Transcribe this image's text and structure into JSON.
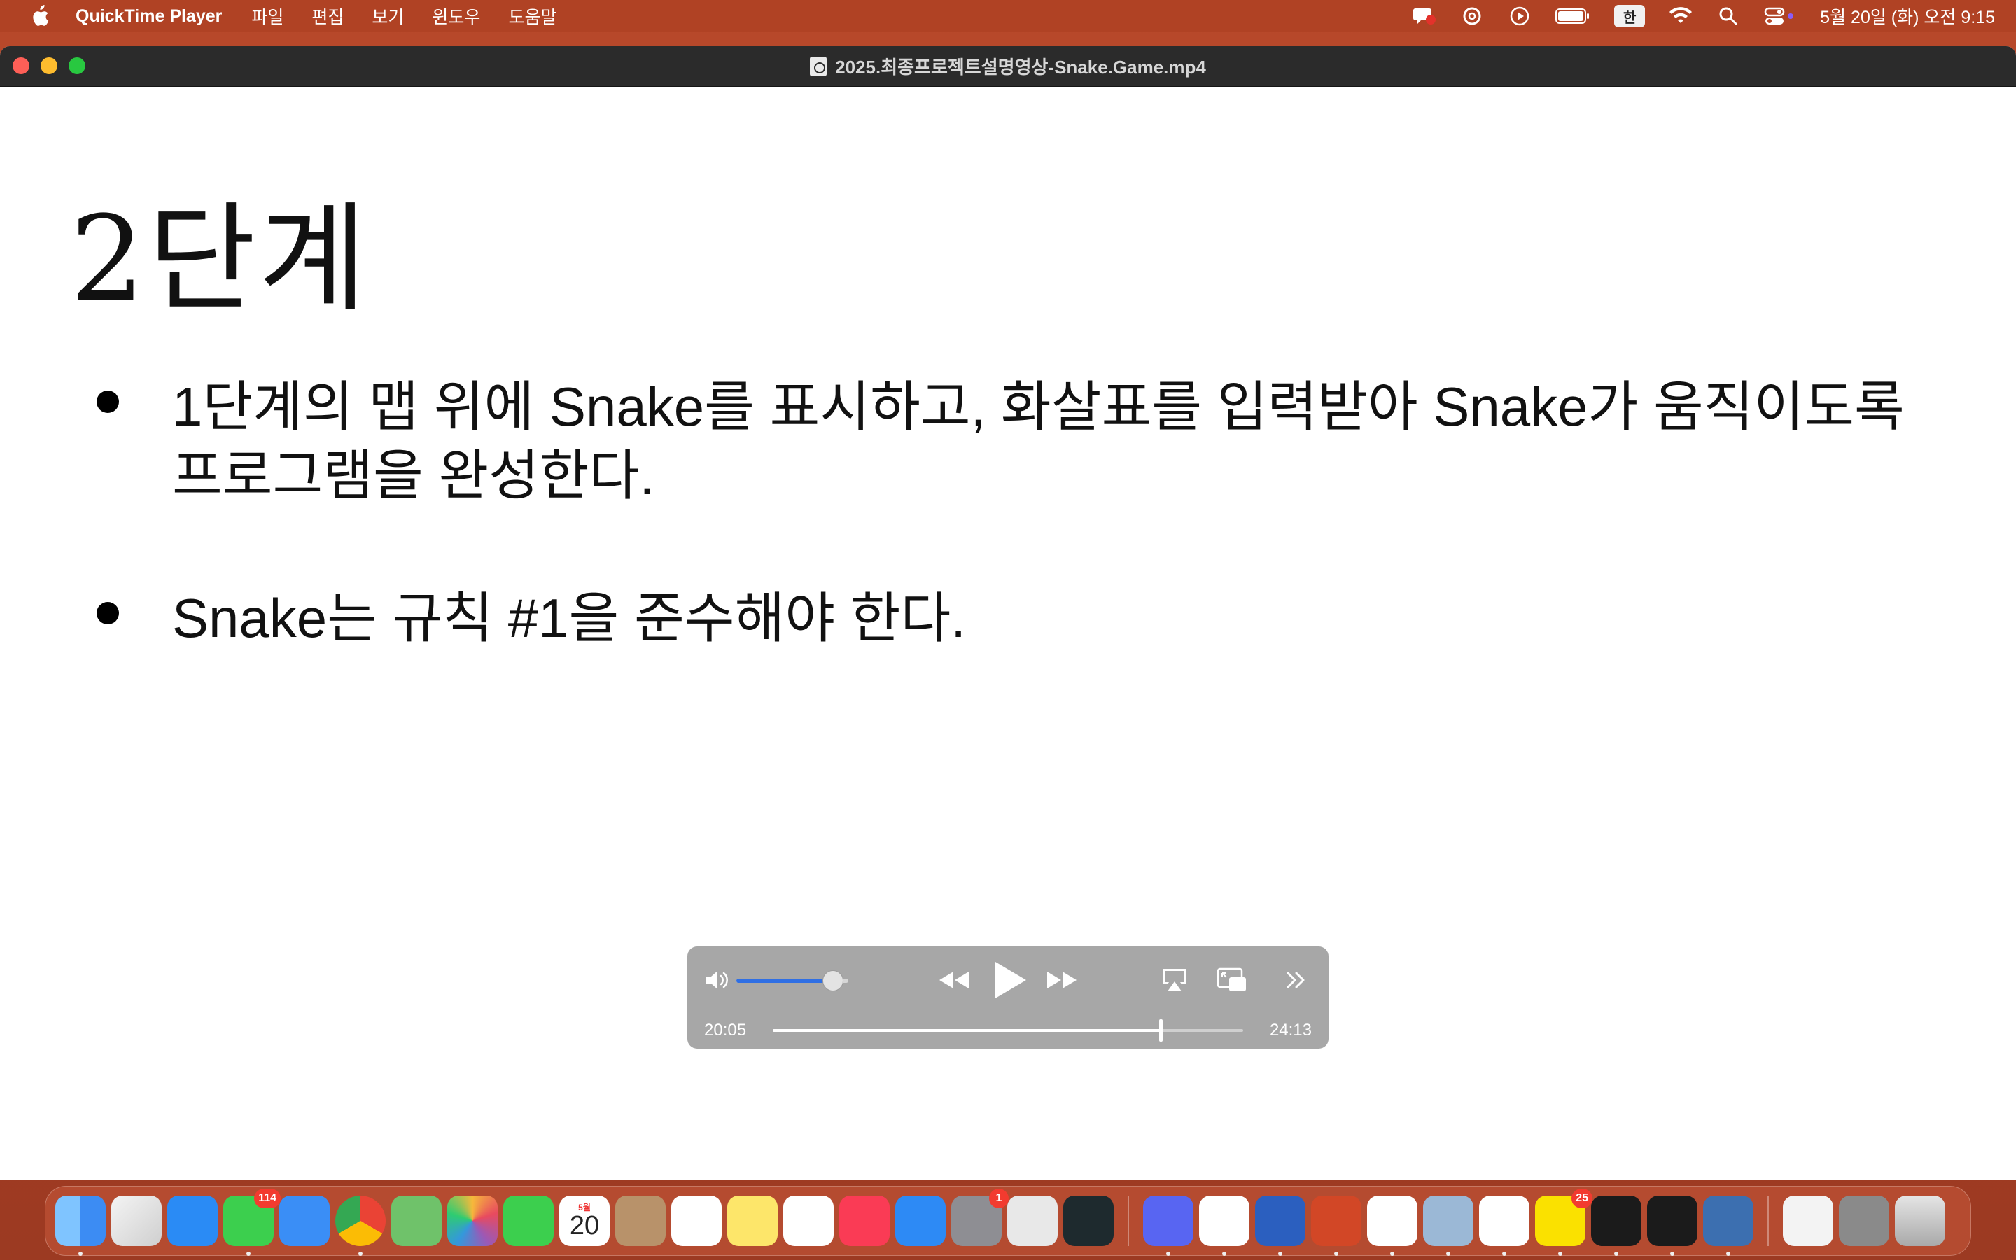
{
  "menubar": {
    "app_name": "QuickTime Player",
    "menus": [
      "파일",
      "편집",
      "보기",
      "윈도우",
      "도움말"
    ],
    "input_method": "한",
    "clock": "5월 20일 (화) 오전 9:15"
  },
  "window": {
    "title": "2025.최종프로젝트설명영상-Snake.Game.mp4"
  },
  "slide": {
    "heading": "2단계",
    "bullets": [
      "1단계의 맵 위에 Snake를 표시하고, 화살표를 입력받아 Snake가 움직이도록 프로그램을 완성한다.",
      "Snake는 규칙 #1을 준수해야 한다."
    ]
  },
  "player": {
    "current_time": "20:05",
    "remaining_time": "24:13",
    "volume_fraction": 0.86,
    "progress_fraction": 0.825
  },
  "dock": {
    "items": [
      {
        "name": "finder",
        "color": "#3c8cf3",
        "running": true
      },
      {
        "name": "launchpad",
        "color": "#d9d9d9",
        "running": false
      },
      {
        "name": "safari",
        "color": "#2a8bf5",
        "running": false
      },
      {
        "name": "messages",
        "color": "#3ccf4e",
        "running": true,
        "badge": "114"
      },
      {
        "name": "mail",
        "color": "#3a8ef6",
        "running": false
      },
      {
        "name": "chrome",
        "color": "#ffffff",
        "running": true
      },
      {
        "name": "maps",
        "color": "#6fc26a",
        "running": false
      },
      {
        "name": "photos",
        "color": "#ffffff",
        "running": false
      },
      {
        "name": "facetime",
        "color": "#3ccf4e",
        "running": false
      },
      {
        "name": "calendar",
        "color": "#ffffff",
        "running": false,
        "month": "5월",
        "day": "20"
      },
      {
        "name": "contacts",
        "color": "#b8926a",
        "running": false
      },
      {
        "name": "reminders",
        "color": "#ffffff",
        "running": false
      },
      {
        "name": "notes",
        "color": "#fde66a",
        "running": false
      },
      {
        "name": "freeform",
        "color": "#ffffff",
        "running": false
      },
      {
        "name": "music",
        "color": "#fa3b55",
        "running": false
      },
      {
        "name": "app-store",
        "color": "#2d8af5",
        "running": false
      },
      {
        "name": "system-settings",
        "color": "#8e8e93",
        "running": false,
        "badge": "1"
      },
      {
        "name": "iphone-mirroring",
        "color": "#e8e8e8",
        "running": false
      },
      {
        "name": "perplexity",
        "color": "#1e2a2e",
        "running": false
      },
      {
        "name": "discord",
        "color": "#5865f2",
        "running": true
      },
      {
        "name": "slack",
        "color": "#ffffff",
        "running": true
      },
      {
        "name": "word",
        "color": "#2b5fbf",
        "running": true
      },
      {
        "name": "powerpoint",
        "color": "#d24726",
        "running": true
      },
      {
        "name": "chatgpt",
        "color": "#ffffff",
        "running": true
      },
      {
        "name": "preview",
        "color": "#9bb8d6",
        "running": true
      },
      {
        "name": "vscode",
        "color": "#ffffff",
        "running": true
      },
      {
        "name": "kakaotalk",
        "color": "#fae100",
        "running": true,
        "badge": "25"
      },
      {
        "name": "terminal",
        "color": "#1b1b1b",
        "running": true
      },
      {
        "name": "cursor",
        "color": "#1b1b1b",
        "running": true
      },
      {
        "name": "quicktime",
        "color": "#3c6fb0",
        "running": true
      },
      {
        "name": "recent-document",
        "color": "#f3f3f3",
        "running": false
      },
      {
        "name": "recent-photo",
        "color": "#8a8a8a",
        "running": false
      },
      {
        "name": "trash",
        "color": "#c8c8c8",
        "running": false
      }
    ]
  },
  "colors": {
    "desktop": "#b8492a",
    "titlebar": "#2b2b2b",
    "controls_bg": "#a0a0a0",
    "volume_fill": "#2f6fe4"
  }
}
